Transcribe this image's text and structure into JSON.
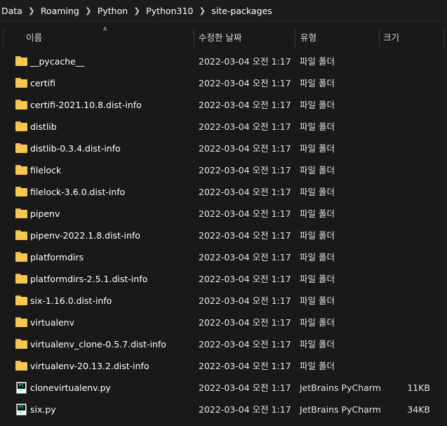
{
  "breadcrumb": [
    "Data",
    "Roaming",
    "Python",
    "Python310",
    "site-packages"
  ],
  "columns": {
    "name": "이름",
    "date": "수정한 날짜",
    "type": "유형",
    "size": "크기"
  },
  "icons": {
    "folder": "folder-icon",
    "file": "pycharm-file-icon",
    "sort": "sort-ascending-caret-icon",
    "separator": "chevron-right-icon"
  },
  "colors": {
    "background": "#191919",
    "folder": "#f5c84f",
    "pycharm_accent": "#21d789"
  },
  "rows": [
    {
      "name": "__pycache__",
      "date": "2022-03-04 오전 1:17",
      "type": "파일 폴더",
      "size": "",
      "kind": "folder"
    },
    {
      "name": "certifi",
      "date": "2022-03-04 오전 1:17",
      "type": "파일 폴더",
      "size": "",
      "kind": "folder"
    },
    {
      "name": "certifi-2021.10.8.dist-info",
      "date": "2022-03-04 오전 1:17",
      "type": "파일 폴더",
      "size": "",
      "kind": "folder"
    },
    {
      "name": "distlib",
      "date": "2022-03-04 오전 1:17",
      "type": "파일 폴더",
      "size": "",
      "kind": "folder"
    },
    {
      "name": "distlib-0.3.4.dist-info",
      "date": "2022-03-04 오전 1:17",
      "type": "파일 폴더",
      "size": "",
      "kind": "folder"
    },
    {
      "name": "filelock",
      "date": "2022-03-04 오전 1:17",
      "type": "파일 폴더",
      "size": "",
      "kind": "folder"
    },
    {
      "name": "filelock-3.6.0.dist-info",
      "date": "2022-03-04 오전 1:17",
      "type": "파일 폴더",
      "size": "",
      "kind": "folder"
    },
    {
      "name": "pipenv",
      "date": "2022-03-04 오전 1:17",
      "type": "파일 폴더",
      "size": "",
      "kind": "folder"
    },
    {
      "name": "pipenv-2022.1.8.dist-info",
      "date": "2022-03-04 오전 1:17",
      "type": "파일 폴더",
      "size": "",
      "kind": "folder"
    },
    {
      "name": "platformdirs",
      "date": "2022-03-04 오전 1:17",
      "type": "파일 폴더",
      "size": "",
      "kind": "folder"
    },
    {
      "name": "platformdirs-2.5.1.dist-info",
      "date": "2022-03-04 오전 1:17",
      "type": "파일 폴더",
      "size": "",
      "kind": "folder"
    },
    {
      "name": "six-1.16.0.dist-info",
      "date": "2022-03-04 오전 1:17",
      "type": "파일 폴더",
      "size": "",
      "kind": "folder"
    },
    {
      "name": "virtualenv",
      "date": "2022-03-04 오전 1:17",
      "type": "파일 폴더",
      "size": "",
      "kind": "folder"
    },
    {
      "name": "virtualenv_clone-0.5.7.dist-info",
      "date": "2022-03-04 오전 1:17",
      "type": "파일 폴더",
      "size": "",
      "kind": "folder"
    },
    {
      "name": "virtualenv-20.13.2.dist-info",
      "date": "2022-03-04 오전 1:17",
      "type": "파일 폴더",
      "size": "",
      "kind": "folder"
    },
    {
      "name": "clonevirtualenv.py",
      "date": "2022-03-04 오전 1:17",
      "type": "JetBrains PyCharm",
      "size": "11KB",
      "kind": "file"
    },
    {
      "name": "six.py",
      "date": "2022-03-04 오전 1:17",
      "type": "JetBrains PyCharm",
      "size": "34KB",
      "kind": "file"
    }
  ]
}
